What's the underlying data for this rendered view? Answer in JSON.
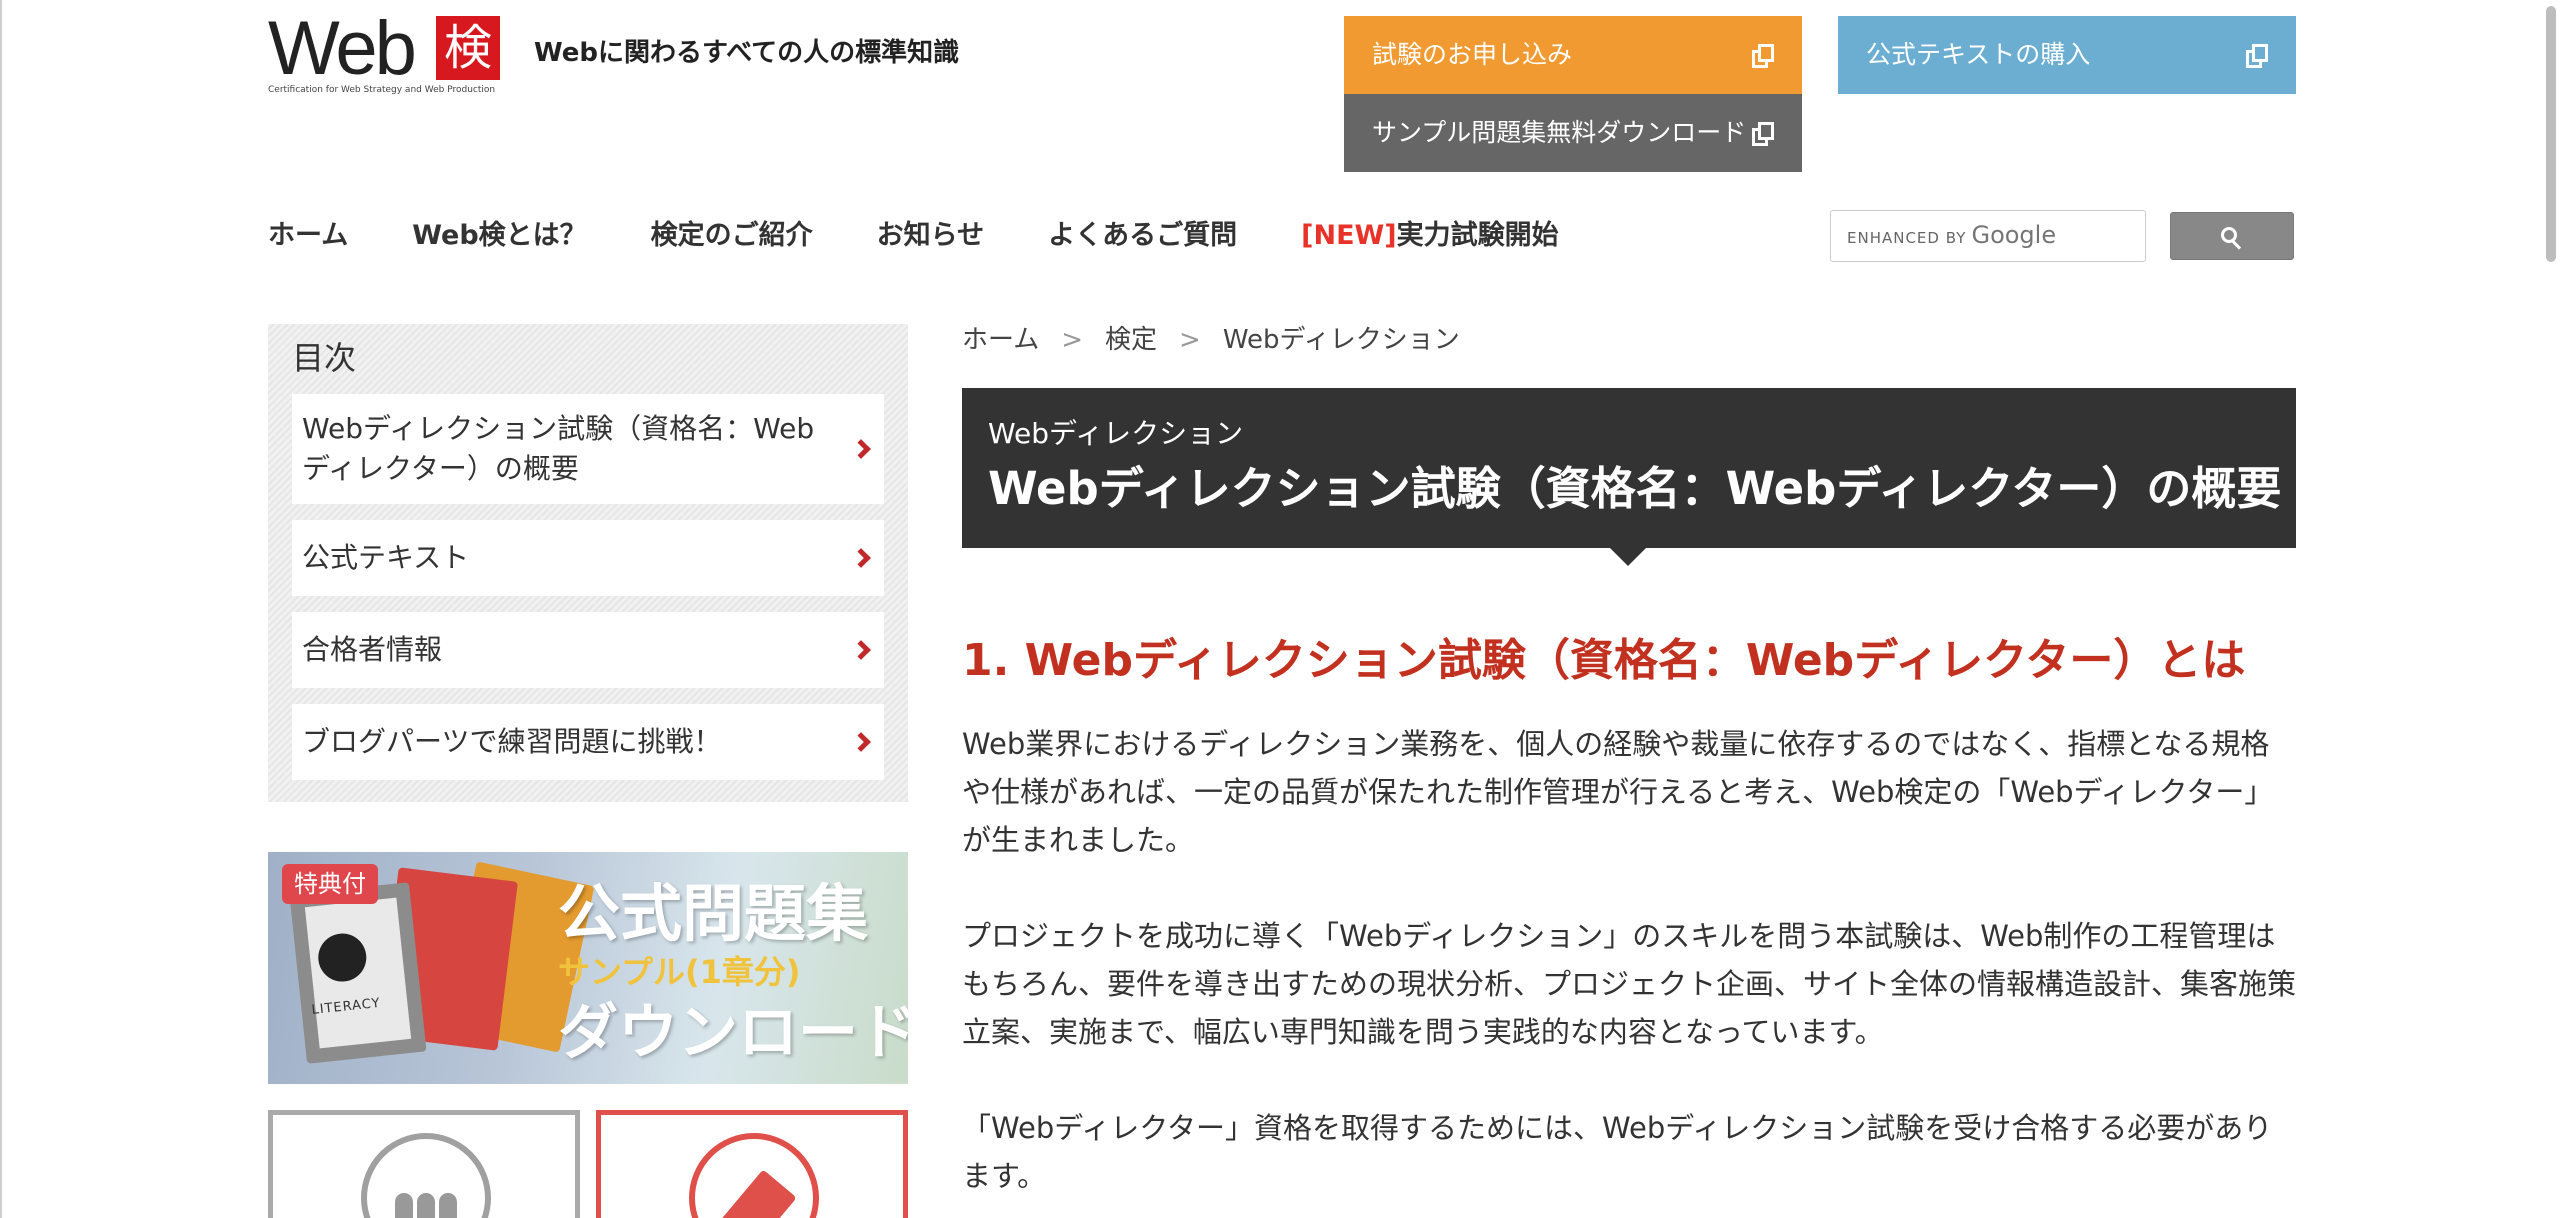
{
  "header": {
    "logo_text": "Web",
    "logo_kanji": "検",
    "logo_subtitle": "Certification for Web Strategy and Web Production",
    "tagline": "Webに関わるすべての人の標準知識",
    "buttons": {
      "apply": "試験のお申し込み",
      "text_purchase": "公式テキストの購入",
      "sample_download": "サンプル問題集無料ダウンロード"
    },
    "colors": {
      "apply": "#f29a32",
      "text_purchase": "#6baed1",
      "sample_download": "#666666"
    }
  },
  "nav": {
    "items": [
      "ホーム",
      "Web検とは？",
      "検定のご紹介",
      "お知らせ",
      "よくあるご質問"
    ],
    "new_tag": "[NEW]",
    "new_item": "実力試験開始"
  },
  "search": {
    "enhanced_by": "ENHANCED BY",
    "brand": "Google",
    "value": ""
  },
  "sidebar": {
    "toc_title": "目次",
    "toc_items": [
      "Webディレクション試験（資格名：Webディレクター）の概要",
      "公式テキスト",
      "合格者情報",
      "ブログパーツで練習問題に挑戦！"
    ],
    "banner": {
      "badge": "特典付",
      "line1": "公式問題集",
      "line2": "サンプル(1章分)",
      "line3": "ダウンロード",
      "book_label": "LITERACY"
    }
  },
  "breadcrumb": {
    "items": [
      "ホーム",
      "検定",
      "Webディレクション"
    ],
    "separator": ">"
  },
  "main": {
    "category": "Webディレクション",
    "title": "Webディレクション試験（資格名：Webディレクター）の概要",
    "section_title": "1. Webディレクション試験（資格名：Webディレクター）とは",
    "paragraphs": [
      "Web業界におけるディレクション業務を、個人の経験や裁量に依存するのではなく、指標となる規格や仕様があれば、一定の品質が保たれた制作管理が行えると考え、Web検定の「Webディレクター」が生まれました。",
      "プロジェクトを成功に導く「Webディレクション」のスキルを問う本試験は、Web制作の工程管理はもちろん、要件を導き出すための現状分析、プロジェクト企画、サイト全体の情報構造設計、集客施策立案、実施まで、幅広い専門知識を問う実践的な内容となっています。",
      "「Webディレクター」資格を取得するためには、Webディレクション試験を受け合格する必要があります。"
    ],
    "accent_color": "#c2311f"
  }
}
